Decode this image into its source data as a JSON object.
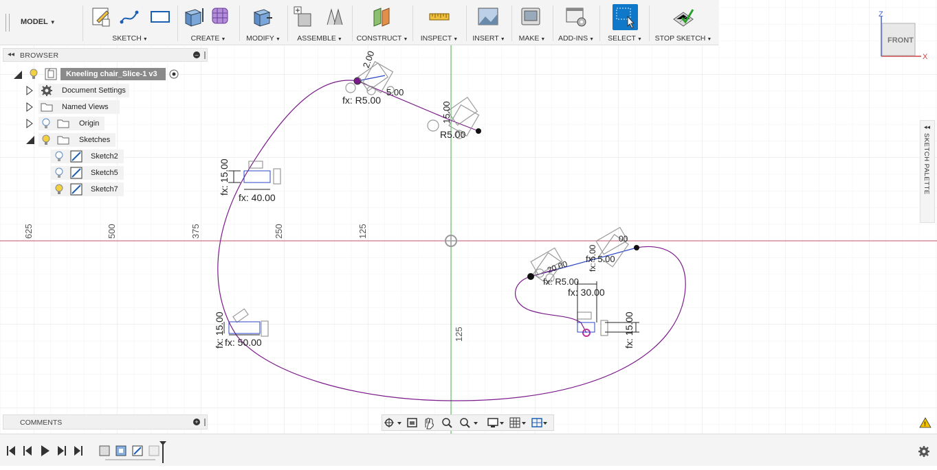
{
  "toolbar": {
    "workspace": "MODEL",
    "groups": [
      {
        "label": "SKETCH"
      },
      {
        "label": "CREATE"
      },
      {
        "label": "MODIFY"
      },
      {
        "label": "ASSEMBLE"
      },
      {
        "label": "CONSTRUCT"
      },
      {
        "label": "INSPECT"
      },
      {
        "label": "INSERT"
      },
      {
        "label": "MAKE"
      },
      {
        "label": "ADD-INS"
      },
      {
        "label": "SELECT"
      },
      {
        "label": "STOP SKETCH"
      }
    ]
  },
  "browser": {
    "title": "BROWSER",
    "root": "Kneeling chair_Slice-1 v3",
    "items": [
      {
        "label": "Document Settings"
      },
      {
        "label": "Named Views"
      },
      {
        "label": "Origin"
      },
      {
        "label": "Sketches"
      }
    ],
    "sketches": [
      {
        "label": "Sketch2"
      },
      {
        "label": "Sketch5"
      },
      {
        "label": "Sketch7"
      }
    ]
  },
  "comments": {
    "title": "COMMENTS"
  },
  "viewcube": {
    "face": "FRONT",
    "axis_z": "Z",
    "axis_x": "X"
  },
  "palette": {
    "title": "SKETCH PALETTE"
  },
  "axis_ticks": {
    "h": [
      "625",
      "500",
      "375",
      "250",
      "125"
    ],
    "v": [
      "125"
    ]
  },
  "dimensions": {
    "d1": "fx: R5.00",
    "d2": "R5.00",
    "d3": "fx: 15.00",
    "d4": "fx: 40.00",
    "d5": "fx: 15.00",
    "d6": "fx: 50.00",
    "d7": "fx: 30.00",
    "d8": "fx: 15.00",
    "d9": "fx: R5.00",
    "d10": "fx: 5.00",
    "d11": "5.00",
    "d12": "15.00",
    "d13": "2.00",
    "d14": "fx: 5.00",
    "d15": "00",
    "d16": "20.00"
  },
  "colors": {
    "profile": "#7a1a8a",
    "x_axis": "#c0506a",
    "y_axis": "#4ac04a",
    "grid": "#e6e6e6",
    "select_active": "#1078c8"
  }
}
